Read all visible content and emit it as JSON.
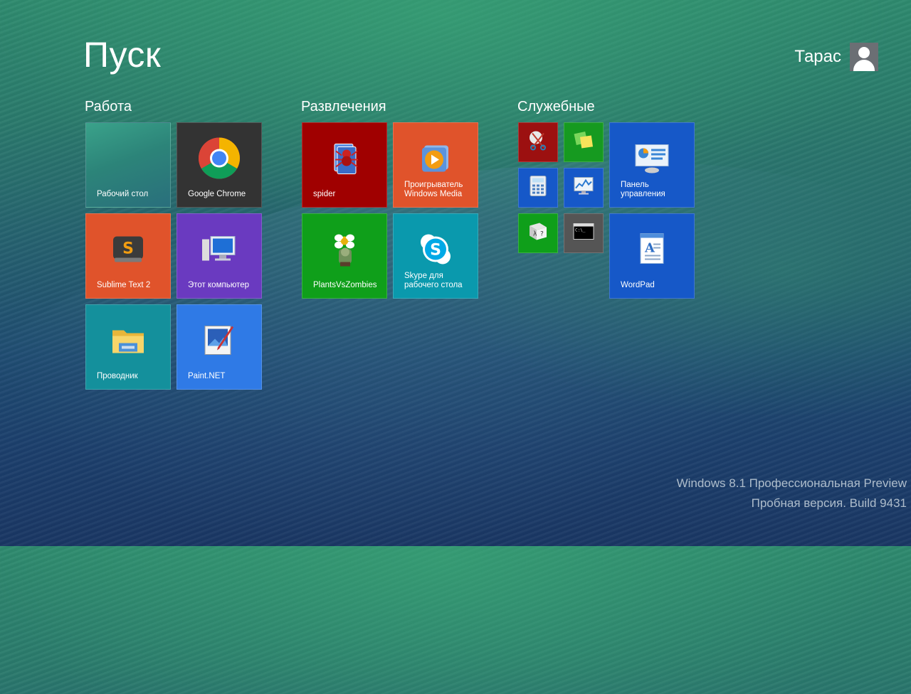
{
  "header": {
    "title": "Пуск",
    "user_name": "Тарас"
  },
  "groups": [
    {
      "title": "Работа"
    },
    {
      "title": "Развлечения"
    },
    {
      "title": "Служебные"
    }
  ],
  "tiles": {
    "desktop": {
      "label": "Рабочий стол",
      "color": "#2f8a78"
    },
    "chrome": {
      "label": "Google Chrome",
      "color": "#333333"
    },
    "sublime": {
      "label": "Sublime Text 2",
      "color": "#e0532b"
    },
    "computer": {
      "label": "Этот компьютер",
      "color": "#6a3ac0"
    },
    "explorer": {
      "label": "Проводник",
      "color": "#14909c"
    },
    "paintnet": {
      "label": "Paint.NET",
      "color": "#2f7ae6"
    },
    "spider": {
      "label": "spider",
      "color": "#a00000"
    },
    "wmp": {
      "label": "Проигрыватель\nWindows Media",
      "color": "#e0532b"
    },
    "pvz": {
      "label": "PlantsVsZombies",
      "color": "#0f9f1a"
    },
    "skype": {
      "label": "Skype для\nрабочего стола",
      "color": "#0a99ad"
    },
    "snipping": {
      "label": "",
      "color": "#9c1010"
    },
    "sticky": {
      "label": "",
      "color": "#169a20"
    },
    "control_panel": {
      "label": "Панель\nуправления",
      "color": "#1658c8"
    },
    "calculator": {
      "label": "",
      "color": "#1658c8"
    },
    "perf_monitor": {
      "label": "",
      "color": "#1658c8"
    },
    "math_input": {
      "label": "",
      "color": "#0f9f1a"
    },
    "cmd": {
      "label": "",
      "color": "#555555"
    },
    "wordpad": {
      "label": "WordPad",
      "color": "#1658c8"
    }
  },
  "footer": {
    "line1": "Windows 8.1 Профессиональная Preview",
    "line2": "Пробная версия. Build 9431"
  }
}
